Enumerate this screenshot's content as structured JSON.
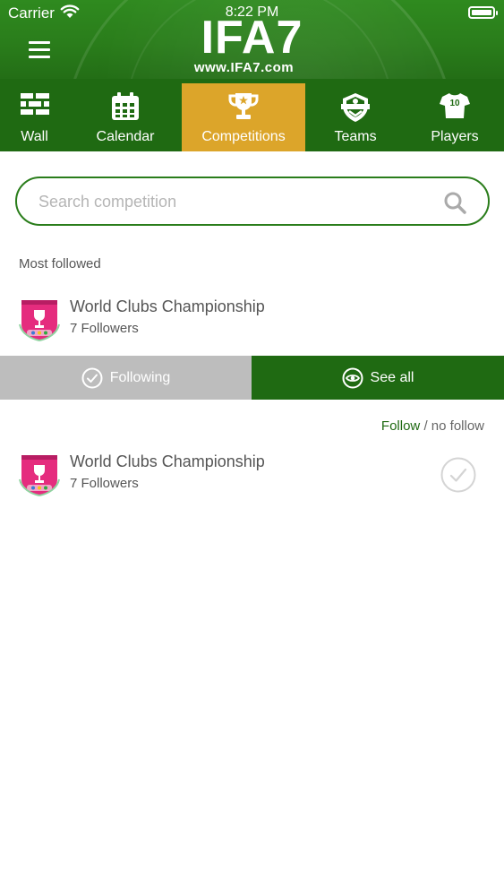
{
  "status_bar": {
    "carrier": "Carrier",
    "time": "8:22 PM"
  },
  "header": {
    "logo": "IFA7",
    "url": "www.IFA7.com"
  },
  "nav": {
    "tabs": [
      {
        "label": "Wall",
        "icon": "wall-icon"
      },
      {
        "label": "Calendar",
        "icon": "calendar-icon"
      },
      {
        "label": "Competitions",
        "icon": "trophy-icon",
        "active": true
      },
      {
        "label": "Teams",
        "icon": "team-shield-icon"
      },
      {
        "label": "Players",
        "icon": "jersey-icon"
      }
    ]
  },
  "search": {
    "placeholder": "Search competition"
  },
  "most_followed": {
    "title": "Most followed",
    "item": {
      "name": "World Clubs Championship",
      "followers": "7 Followers"
    }
  },
  "actions": {
    "following_label": "Following",
    "see_all_label": "See all"
  },
  "legend": {
    "follow": "Follow",
    "separator": "/",
    "no_follow": "no follow"
  },
  "list": {
    "items": [
      {
        "name": "World Clubs Championship",
        "followers": "7 Followers",
        "followed": false
      }
    ]
  },
  "colors": {
    "primary_green": "#1f6a12",
    "active_tab": "#dca52a",
    "following_gray": "#bdbdbd"
  }
}
